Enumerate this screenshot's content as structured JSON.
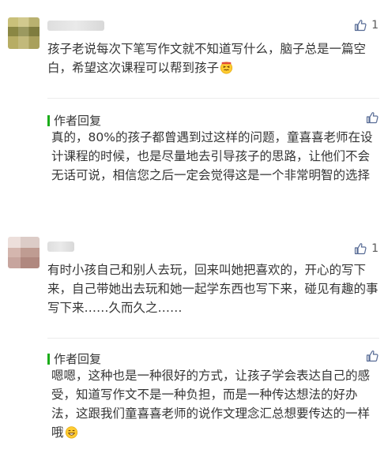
{
  "comments": [
    {
      "text": "孩子老说每次下笔写作文就不知道写什么，脑子总是一篇空白，希望这次课程可以帮到孩子",
      "emoji_icon": "confounded-face-emoji",
      "like_count": "1",
      "reply_title": "作者回复",
      "reply_text": "真的，80%的孩子都曾遇到过这样的问题，童喜喜老师在设计课程的时候，也是尽量地去引导孩子的思路，让他们不会无话可说，相信您之后一定会觉得这是一个非常明智的选择"
    },
    {
      "text": "有时小孩自己和别人去玩，回来叫她把喜欢的，开心的写下来，自己带她出去玩和她一起学东西也写下来，碰见有趣的事写下来……久而久之……",
      "like_count": "1",
      "reply_title": "作者回复",
      "reply_text": "嗯嗯，这种也是一种很好的方式，让孩子学会表达自己的感受，知道写作文不是一种负担，而是一种传达想法的好办法，这跟我们童喜喜老师的说作文理念汇总想要传达的一样哦",
      "reply_emoji_icon": "grinning-face-emoji"
    }
  ],
  "colors": {
    "reply_mark": "#1aad19",
    "text": "#353535",
    "like_icon": "#576b95"
  }
}
